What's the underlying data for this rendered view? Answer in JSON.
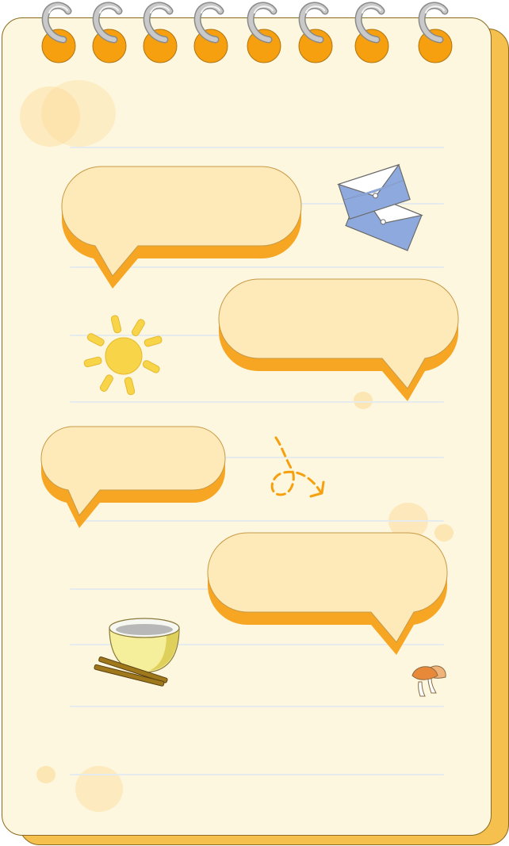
{
  "colors": {
    "paper": "#fdf7df",
    "shadow": "#f5c04e",
    "bubble_fill": "#fdeab8",
    "bubble_edge": "#f6a623",
    "accent_orange": "#f6a00f",
    "ring_silver": "#c9c9c9",
    "ruled_line": "#e6ecee",
    "envelope_blue": "#8ea9de",
    "sun_yellow": "#f7d448"
  },
  "binding": {
    "ring_count": 8
  },
  "bubbles": [
    {
      "text": "",
      "tail": "left"
    },
    {
      "text": "",
      "tail": "right"
    },
    {
      "text": "",
      "tail": "left"
    },
    {
      "text": "",
      "tail": "right"
    }
  ],
  "decorations": {
    "icons": [
      "envelope-icon",
      "sun-icon",
      "dashed-arrow-icon",
      "rice-bowl-icon",
      "mushroom-icon"
    ]
  }
}
